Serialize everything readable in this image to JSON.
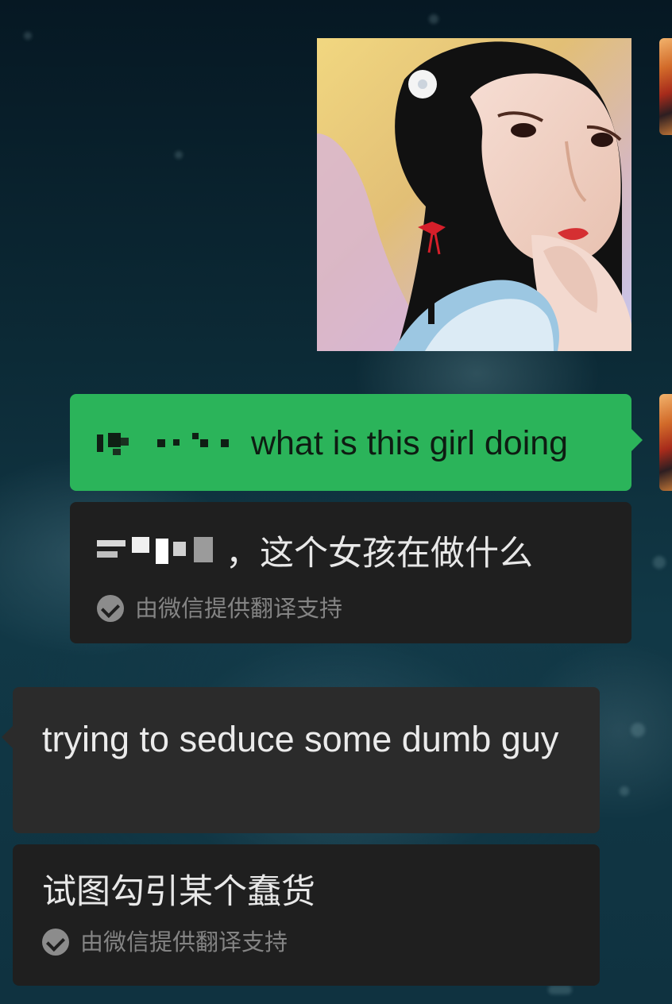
{
  "messages": [
    {
      "type": "image",
      "alt": "",
      "from": "me"
    },
    {
      "type": "text",
      "from": "me",
      "text": "what is this girl doing",
      "translation": "，这个女孩在做什么",
      "translation_support": "由微信提供翻译支持"
    },
    {
      "type": "text",
      "from": "other",
      "text": "trying to seduce some dumb guy",
      "translation": "试图勾引某个蠢货",
      "translation_support": "由微信提供翻译支持"
    }
  ],
  "colors": {
    "sent_bubble": "#2bb45a",
    "received_bubble": "#2b2b2b",
    "translation_card": "#1f1f1f",
    "support_text": "#848484"
  },
  "icons": {
    "translation_check": "check-circle-icon",
    "avatar_right": "avatar"
  }
}
